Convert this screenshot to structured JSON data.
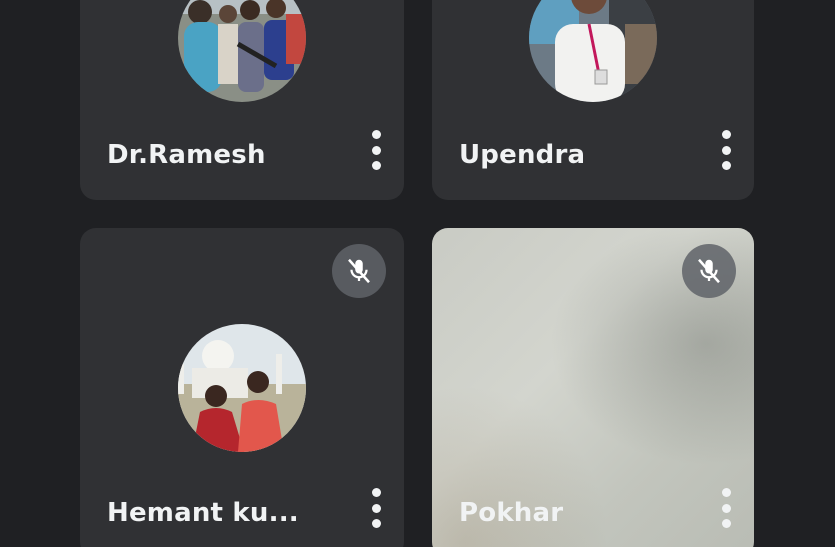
{
  "participants": [
    {
      "name": "Dr.Ramesh",
      "muted": false,
      "avatar_icon": "person-photo-icon"
    },
    {
      "name": "Upendra",
      "muted": false,
      "avatar_icon": "person-photo-icon"
    },
    {
      "name": "Hemant ku...",
      "muted": true,
      "avatar_icon": "person-photo-icon"
    },
    {
      "name": "Pokhar",
      "muted": true,
      "video_on": true
    }
  ],
  "colors": {
    "background": "#1f2023",
    "tile": "#303134",
    "text": "#f1f3f4",
    "mute_badge": "#5f6368"
  },
  "icons": {
    "more": "more-vert-icon",
    "mute": "mic-off-icon"
  }
}
